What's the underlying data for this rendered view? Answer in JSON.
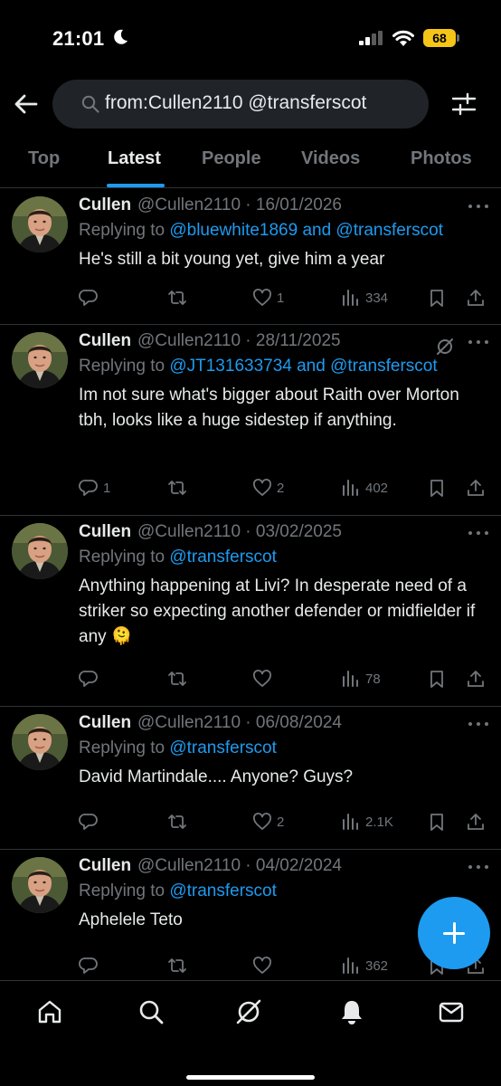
{
  "status_bar": {
    "time": "21:01",
    "battery": "68"
  },
  "search": {
    "query": "from:Cullen2110 @transferscot"
  },
  "tabs": [
    {
      "label": "Top",
      "active": false
    },
    {
      "label": "Latest",
      "active": true
    },
    {
      "label": "People",
      "active": false
    },
    {
      "label": "Videos",
      "active": false
    },
    {
      "label": "Photos",
      "active": false
    }
  ],
  "tweets": [
    {
      "name": "Cullen",
      "handle_date": "@Cullen2110 · 16/01/2026",
      "replying_prefix": "Replying to ",
      "replying_mentions": "@bluewhite1869 and @transferscot",
      "text": "He's still a bit young yet, give him a year",
      "replies": "",
      "reposts": "",
      "likes": "1",
      "views": "334"
    },
    {
      "name": "Cullen",
      "handle_date": "@Cullen2110 · 28/11/2025",
      "replying_prefix": "Replying to ",
      "replying_mentions": "@JT131633734 and @transferscot",
      "text": "Im not sure what's bigger about Raith over Morton tbh, looks like a huge sidestep if anything.",
      "replies": "1",
      "reposts": "",
      "likes": "2",
      "views": "402"
    },
    {
      "name": "Cullen",
      "handle_date": "@Cullen2110 · 03/02/2025",
      "replying_prefix": "Replying to ",
      "replying_mentions": "@transferscot",
      "text": "Anything happening at Livi? In desperate need of a striker so expecting another defender or midfielder if any 🫠",
      "replies": "",
      "reposts": "",
      "likes": "",
      "views": "78"
    },
    {
      "name": "Cullen",
      "handle_date": "@Cullen2110 · 06/08/2024",
      "replying_prefix": "Replying to ",
      "replying_mentions": "@transferscot",
      "text": "David Martindale.... Anyone? Guys?",
      "replies": "",
      "reposts": "",
      "likes": "2",
      "views": "2.1K"
    },
    {
      "name": "Cullen",
      "handle_date": "@Cullen2110 · 04/02/2024",
      "replying_prefix": "Replying to ",
      "replying_mentions": "@transferscot",
      "text": "Aphelele Teto",
      "replies": "",
      "reposts": "",
      "likes": "",
      "views": "362"
    }
  ],
  "icons": {
    "back": "arrow-left-icon",
    "search": "search-icon",
    "filter": "filter-sliders-icon",
    "reply": "reply-icon",
    "repost": "repost-icon",
    "like": "heart-icon",
    "views": "views-icon",
    "bookmark": "bookmark-icon",
    "share": "share-icon",
    "compose": "plus-icon",
    "nav": [
      "home-icon",
      "search-icon",
      "grok-icon",
      "notifications-icon",
      "messages-icon"
    ]
  },
  "colors": {
    "accent": "#1d9bf0",
    "background": "#000000",
    "text": "#e7e9ea",
    "muted": "#71767b",
    "battery": "#f5c518"
  }
}
